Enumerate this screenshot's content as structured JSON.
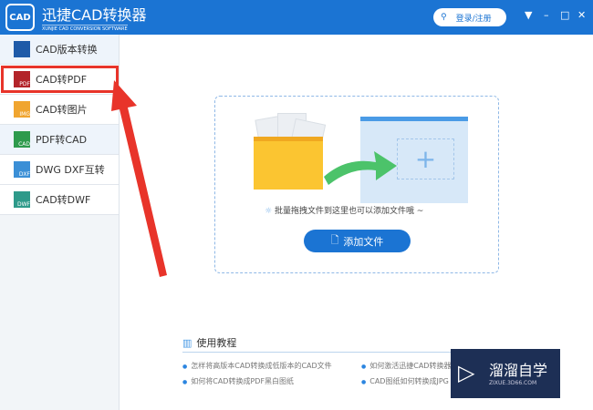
{
  "header": {
    "logo": "CAD",
    "title": "迅捷CAD转换器",
    "subtitle": "XUNJIE CAD CONVERSION SOFTWARE",
    "login": "登录/注册",
    "menu": "▼",
    "minimize": "–",
    "maximize": "□",
    "close": "✕"
  },
  "sidebar": {
    "items": [
      {
        "label": "CAD版本转换",
        "icon": "CAD"
      },
      {
        "label": "CAD转PDF",
        "icon": "PDF"
      },
      {
        "label": "CAD转图片",
        "icon": "IMG"
      },
      {
        "label": "PDF转CAD",
        "icon": "CAD"
      },
      {
        "label": "DWG DXF互转",
        "icon": "DXF"
      },
      {
        "label": "CAD转DWF",
        "icon": "DWF"
      }
    ]
  },
  "main": {
    "hint": "批量拖拽文件到这里也可以添加文件哦 ~",
    "add_button": "添加文件",
    "plus": "+"
  },
  "tutorials": {
    "title": "使用教程",
    "items": [
      "怎样将高版本CAD转换成低版本的CAD文件",
      "如何激活迅捷CAD转换器",
      "如何将CAD转换成PDF黑白图纸",
      "CAD图纸如何转换成JPG"
    ]
  },
  "watermark": {
    "name": "溜溜自学",
    "url": "ZIXUE.3D66.COM"
  },
  "colors": {
    "brand": "#1b74d3",
    "annotation": "#e8342a"
  }
}
